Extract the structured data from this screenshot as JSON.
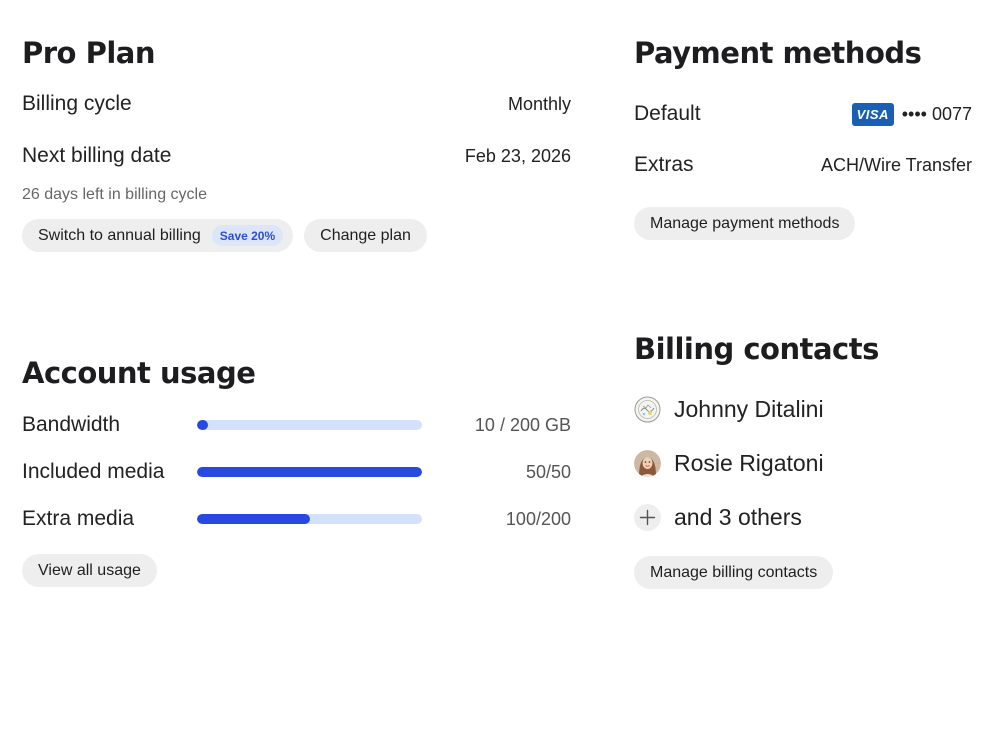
{
  "plan": {
    "title": "Pro Plan",
    "billing_cycle_label": "Billing cycle",
    "billing_cycle_value": "Monthly",
    "next_billing_label": "Next billing date",
    "next_billing_value": "Feb 23, 2026",
    "days_left": "26 days left in billing cycle",
    "switch_button": "Switch to annual billing",
    "save_badge": "Save 20%",
    "change_plan_button": "Change plan"
  },
  "usage": {
    "title": "Account usage",
    "rows": [
      {
        "label": "Bandwidth",
        "value": "10 / 200 GB",
        "fraction": 0.05
      },
      {
        "label": "Included media",
        "value": "50/50",
        "fraction": 1.0
      },
      {
        "label": "Extra media",
        "value": "100/200",
        "fraction": 0.5
      }
    ],
    "view_all_button": "View all usage"
  },
  "payment": {
    "title": "Payment methods",
    "default_label": "Default",
    "card_brand": "VISA",
    "card_number": "•••• 0077",
    "extras_label": "Extras",
    "extras_value": "ACH/Wire Transfer",
    "manage_button": "Manage payment methods"
  },
  "contacts": {
    "title": "Billing contacts",
    "people": [
      {
        "name": "Johnny Ditalini",
        "avatar": "sketch-avatar"
      },
      {
        "name": "Rosie Rigatoni",
        "avatar": "photo-avatar"
      }
    ],
    "others": "and 3 others",
    "manage_button": "Manage billing contacts"
  },
  "colors": {
    "accent": "#2849e0",
    "bar_track": "#d3e1fb",
    "pill_bg": "#eeeeee",
    "badge_bg": "#dce6fb",
    "badge_text": "#2c4fd0",
    "visa": "#1a5fb4"
  }
}
